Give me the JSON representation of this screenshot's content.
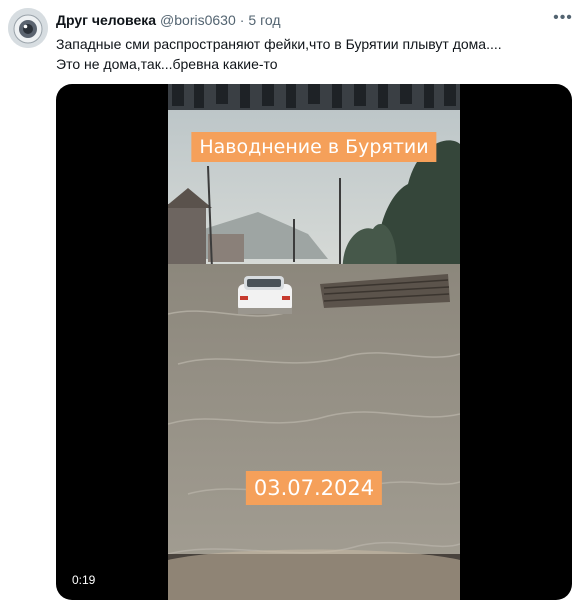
{
  "author": {
    "name": "Друг человека",
    "handle": "@boris0630",
    "separator": "·",
    "time": "5 год"
  },
  "more_icon": "ellipsis-icon",
  "tweet": {
    "lines": [
      "Западные сми распространяют фейки,что в Бурятии плывут дома....",
      "Это не дома,так...бревна какие-то"
    ]
  },
  "video": {
    "overlay_title": "Наводнение в Бурятии",
    "overlay_date": "03.07.2024",
    "duration": "0:19"
  },
  "colors": {
    "overlay_label": "#f5a05a",
    "text_primary": "#0f1419",
    "text_secondary": "#536471"
  }
}
